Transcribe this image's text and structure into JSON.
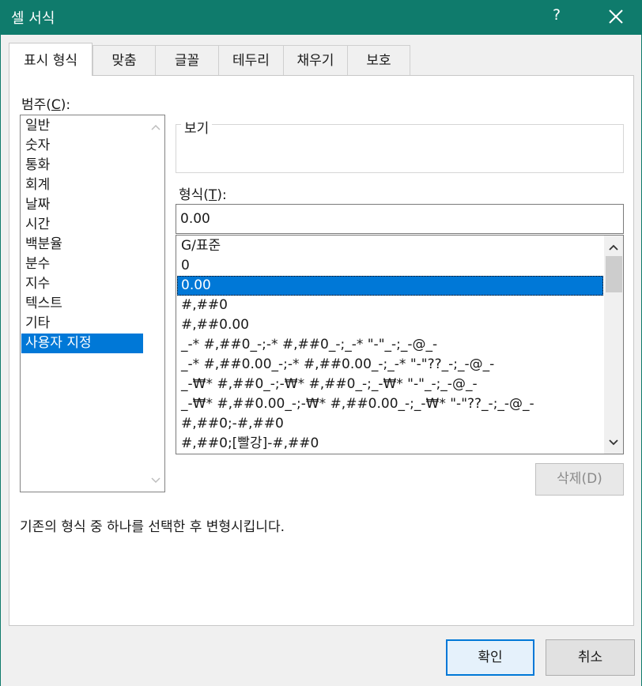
{
  "window": {
    "title": "셀 서식",
    "help_label": "?"
  },
  "tabs": [
    {
      "label": "표시 형식"
    },
    {
      "label": "맞춤"
    },
    {
      "label": "글꼴"
    },
    {
      "label": "테두리"
    },
    {
      "label": "채우기"
    },
    {
      "label": "보호"
    }
  ],
  "category": {
    "label_prefix": "범주(",
    "label_key": "C",
    "label_suffix": "):",
    "items": [
      "일반",
      "숫자",
      "통화",
      "회계",
      "날짜",
      "시간",
      "백분율",
      "분수",
      "지수",
      "텍스트",
      "기타",
      "사용자 지정"
    ],
    "selected": "사용자 지정"
  },
  "preview": {
    "label": "보기",
    "value": ""
  },
  "format": {
    "label_prefix": "형식(",
    "label_key": "T",
    "label_suffix": "):",
    "value": "0.00",
    "items": [
      "G/표준",
      "0",
      "0.00",
      "#,##0",
      "#,##0.00",
      "_-* #,##0_-;-* #,##0_-;_-* \"-\"_-;_-@_-",
      "_-* #,##0.00_-;-* #,##0.00_-;_-* \"-\"??_-;_-@_-",
      "_-₩* #,##0_-;-₩* #,##0_-;_-₩* \"-\"_-;_-@_-",
      "_-₩* #,##0.00_-;-₩* #,##0.00_-;_-₩* \"-\"??_-;_-@_-",
      "#,##0;-#,##0",
      "#,##0;[빨강]-#,##0"
    ],
    "selected": "0.00"
  },
  "delete_button": {
    "label": "삭제(D)"
  },
  "description": "기존의 형식 중 하나를 선택한 후 변형시킵니다.",
  "footer": {
    "ok_label": "확인",
    "cancel_label": "취소"
  },
  "colors": {
    "titlebar": "#0f7b6c",
    "selection": "#0078d7"
  }
}
